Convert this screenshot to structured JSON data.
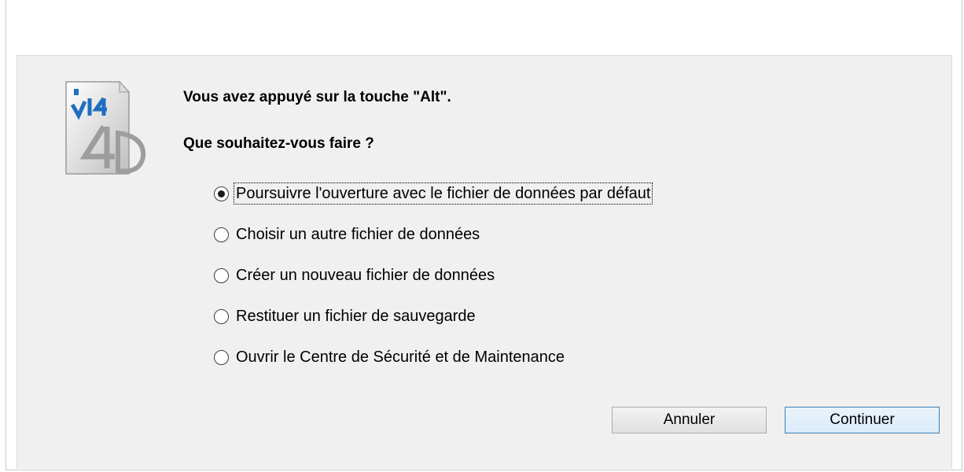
{
  "dialog": {
    "title_line": "Vous avez appuyé sur la touche \"Alt\".",
    "question": "Que souhaitez-vous faire ?",
    "logo": {
      "icon": "4d-v14-logo-icon",
      "version_text": "v14",
      "brand_text": "4D"
    },
    "options": [
      {
        "label": "Poursuivre l'ouverture avec le fichier de données par défaut",
        "selected": true,
        "focused": true
      },
      {
        "label": "Choisir un autre fichier de données",
        "selected": false
      },
      {
        "label": "Créer un nouveau fichier de données",
        "selected": false
      },
      {
        "label": "Restituer un fichier de sauvegarde",
        "selected": false
      },
      {
        "label": "Ouvrir le Centre de Sécurité et de Maintenance",
        "selected": false
      }
    ],
    "buttons": {
      "cancel": "Annuler",
      "continue": "Continuer"
    },
    "colors": {
      "panel": "#f0f0f0",
      "default_button_border": "#3c7fb1"
    }
  }
}
